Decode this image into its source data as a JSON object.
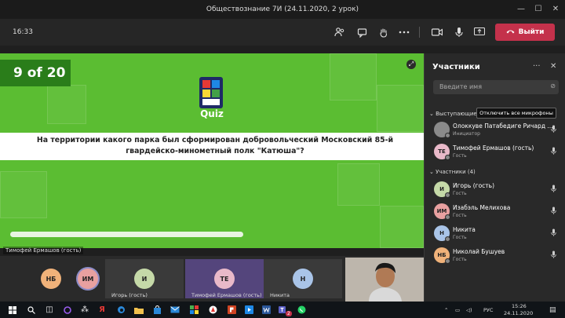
{
  "window": {
    "title": "Обществознание 7И (24.11.2020, 2 урок)",
    "minimize": "—",
    "maximize": "☐",
    "close": "✕"
  },
  "toolbar": {
    "clock": "16:33",
    "leave_label": "Выйти"
  },
  "quiz": {
    "counter": "9 of 20",
    "logo_word": "Quiz",
    "question": "На территории какого парка был сформирован добровольческий Московский 85-й гвардейско-минометный полк \"Катюша\"?",
    "progress": 0.55,
    "presenter_caption": "Тимофей Ермашов (гость)"
  },
  "stage_tiles": [
    {
      "initials": "НБ",
      "name": "",
      "color": "#f0b27a"
    },
    {
      "initials": "ИМ",
      "name": "",
      "color": "#e8a0a0"
    },
    {
      "initials": "И",
      "name": "Игорь (гость)",
      "color": "#c5d9a8"
    },
    {
      "initials": "ТЕ",
      "name": "Тимофей Ермашов (гость)",
      "color": "#e9b9c9"
    },
    {
      "initials": "Н",
      "name": "Никита",
      "color": "#a9c4e8"
    }
  ],
  "panel": {
    "title": "Участники",
    "search_placeholder": "Введите имя",
    "presenters_header": "Выступающие (2)",
    "mute_all_label": "Отключить все микрофоны",
    "attendees_header": "Участники (4)",
    "presenters": [
      {
        "initials": "",
        "name": "Олоккуве Патабедиге Ричард ...",
        "role": "Инициатор",
        "color": "#8a8a8a"
      },
      {
        "initials": "ТЕ",
        "name": "Тимофей Ермашов (гость)",
        "role": "Гость",
        "color": "#e9b9c9"
      }
    ],
    "attendees": [
      {
        "initials": "И",
        "name": "Игорь (гость)",
        "role": "Гость",
        "color": "#c5d9a8"
      },
      {
        "initials": "ИМ",
        "name": "Изабэль Мелихова",
        "role": "Гость",
        "color": "#e8a0a0"
      },
      {
        "initials": "Н",
        "name": "Никита",
        "role": "Гость",
        "color": "#a9c4e8"
      },
      {
        "initials": "НБ",
        "name": "Николай Бушуев",
        "role": "Гость",
        "color": "#f0b27a"
      }
    ]
  },
  "taskbar": {
    "language": "РУС",
    "time": "15:26",
    "date": "24.11.2020",
    "teams_badge": "2"
  }
}
